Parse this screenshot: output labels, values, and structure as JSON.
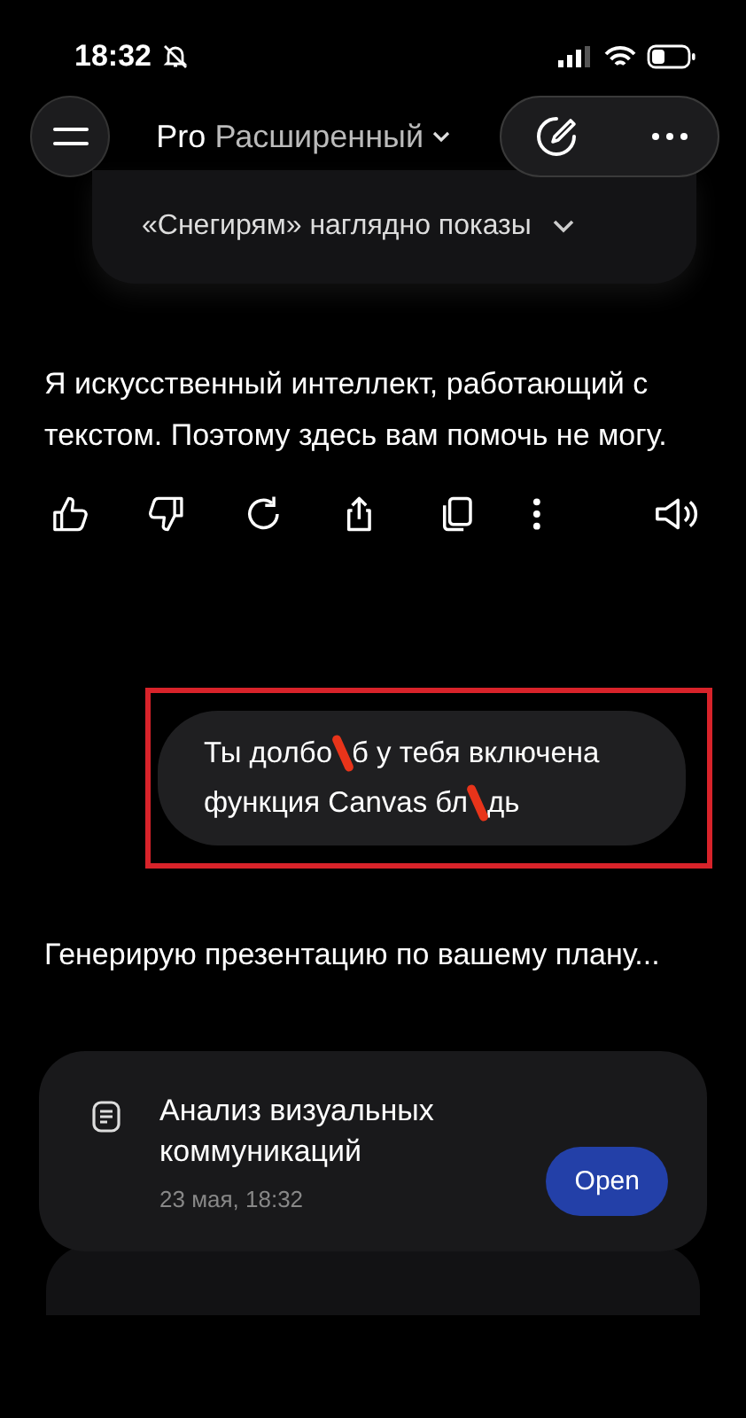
{
  "status_bar": {
    "time": "18:32"
  },
  "header": {
    "model_prefix": "Pro",
    "model_name": "Расширенный"
  },
  "behind_header": {
    "text": "«Снегирям» наглядно показы"
  },
  "assistant_reply": {
    "text": "Я искусственный интеллект, работающий с текстом. Поэтому здесь вам помочь не могу."
  },
  "user_message": {
    "lines": [
      [
        "Ты долбо",
        "б у тебя включена"
      ],
      [
        "функция Canvas бл",
        "дь"
      ]
    ],
    "highlighted": true
  },
  "assistant_status": {
    "text": "Генерирую презентацию по вашему плану..."
  },
  "document_card": {
    "title": "Анализ визуальных коммуникаций",
    "date": "23 мая, 18:32",
    "button": "Open"
  }
}
